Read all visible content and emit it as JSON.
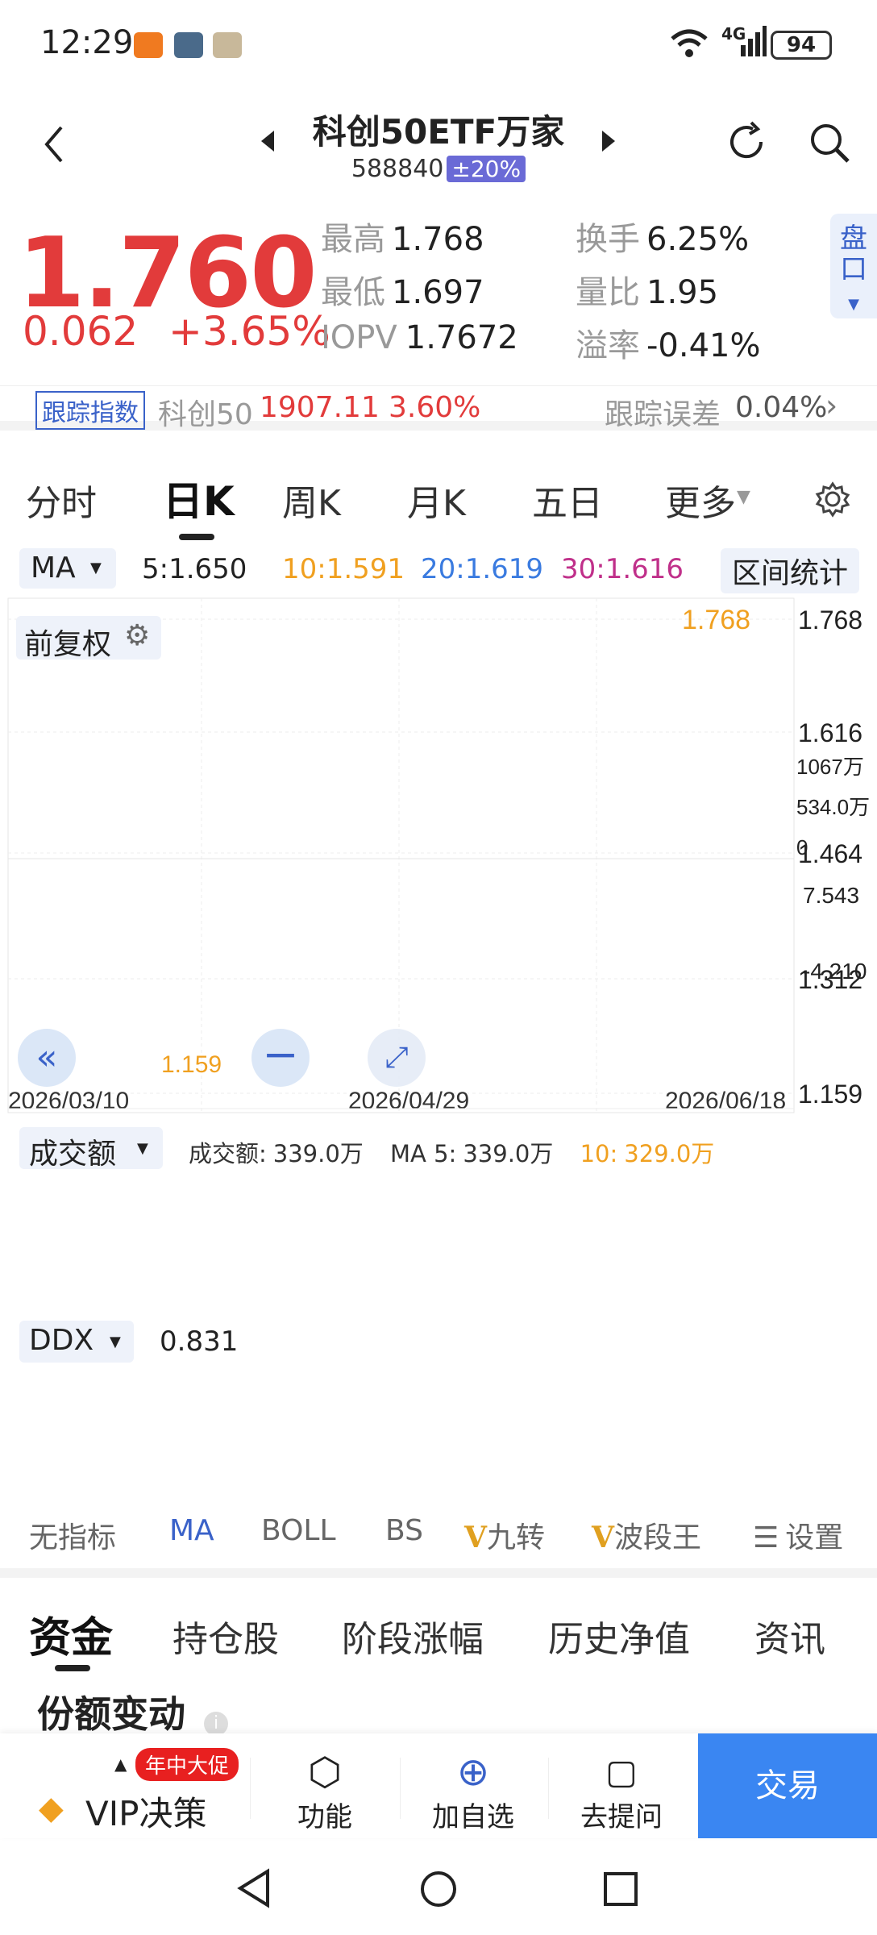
{
  "status_bar": {
    "time": "12:29",
    "network": "4G",
    "battery": "94"
  },
  "header": {
    "title": "科创50ETF万家",
    "code": "588840",
    "limit_badge": "±20%"
  },
  "quote": {
    "price": "1.760",
    "change": "0.062",
    "change_pct": "+3.65%",
    "high_label": "最高",
    "high": "1.768",
    "low_label": "最低",
    "low": "1.697",
    "iopv_label": "IOPV",
    "iopv": "1.7672",
    "turnover_label": "换手",
    "turnover": "6.25%",
    "vol_ratio_label": "量比",
    "vol_ratio": "1.95",
    "premium_label": "溢率",
    "premium": "-0.41%",
    "pankou": "盘口"
  },
  "tracking": {
    "tag": "跟踪指数",
    "index_name": "科创50",
    "index_value": "1907.11",
    "index_pct": "3.60%",
    "error_label": "跟踪误差",
    "error": "0.04%"
  },
  "period_tabs": [
    "分时",
    "日K",
    "周K",
    "月K",
    "五日",
    "更多"
  ],
  "ma_bar": {
    "selector": "MA",
    "ma5": "5:1.650",
    "ma10": "10:1.591",
    "ma20": "20:1.619",
    "ma30": "30:1.616",
    "range_stats": "区间统计"
  },
  "kline": {
    "adjust_label": "前复权",
    "y_ticks": [
      "1.768",
      "1.616",
      "1.464",
      "1.312",
      "1.159"
    ],
    "x_ticks": [
      "2026/03/10",
      "2026/04/29",
      "2026/06/18"
    ],
    "max_label": "1.768",
    "min_label": "1.159"
  },
  "volume": {
    "selector": "成交额",
    "label": "成交额:",
    "value": "339.0万",
    "ma5_label": "MA 5:",
    "ma5": "339.0万",
    "ma10_label": "10:",
    "ma10": "329.0万",
    "y_ticks": [
      "1067万",
      "534.0万",
      "0"
    ]
  },
  "ddx": {
    "selector": "DDX",
    "value": "0.831",
    "y_ticks": [
      "7.543",
      "-4.210"
    ]
  },
  "indicator_tabs": [
    "无指标",
    "MA",
    "BOLL",
    "BS",
    "九转",
    "波段王",
    "设置"
  ],
  "bottom_tabs": [
    "资金",
    "持仓股",
    "阶段涨幅",
    "历史净值",
    "资讯"
  ],
  "section": {
    "title": "份额变动"
  },
  "footer": {
    "promo": "年中大促",
    "vip": "VIP决策",
    "func": "功能",
    "add": "加自选",
    "ask": "去提问",
    "trade": "交易"
  },
  "colors": {
    "up": "#e23b3b",
    "down": "#1f9a4a",
    "accent": "#3a62c9",
    "ma5": "#222222",
    "ma10": "#f0a020",
    "ma20": "#3a7be0",
    "ma30": "#c0308a"
  }
}
